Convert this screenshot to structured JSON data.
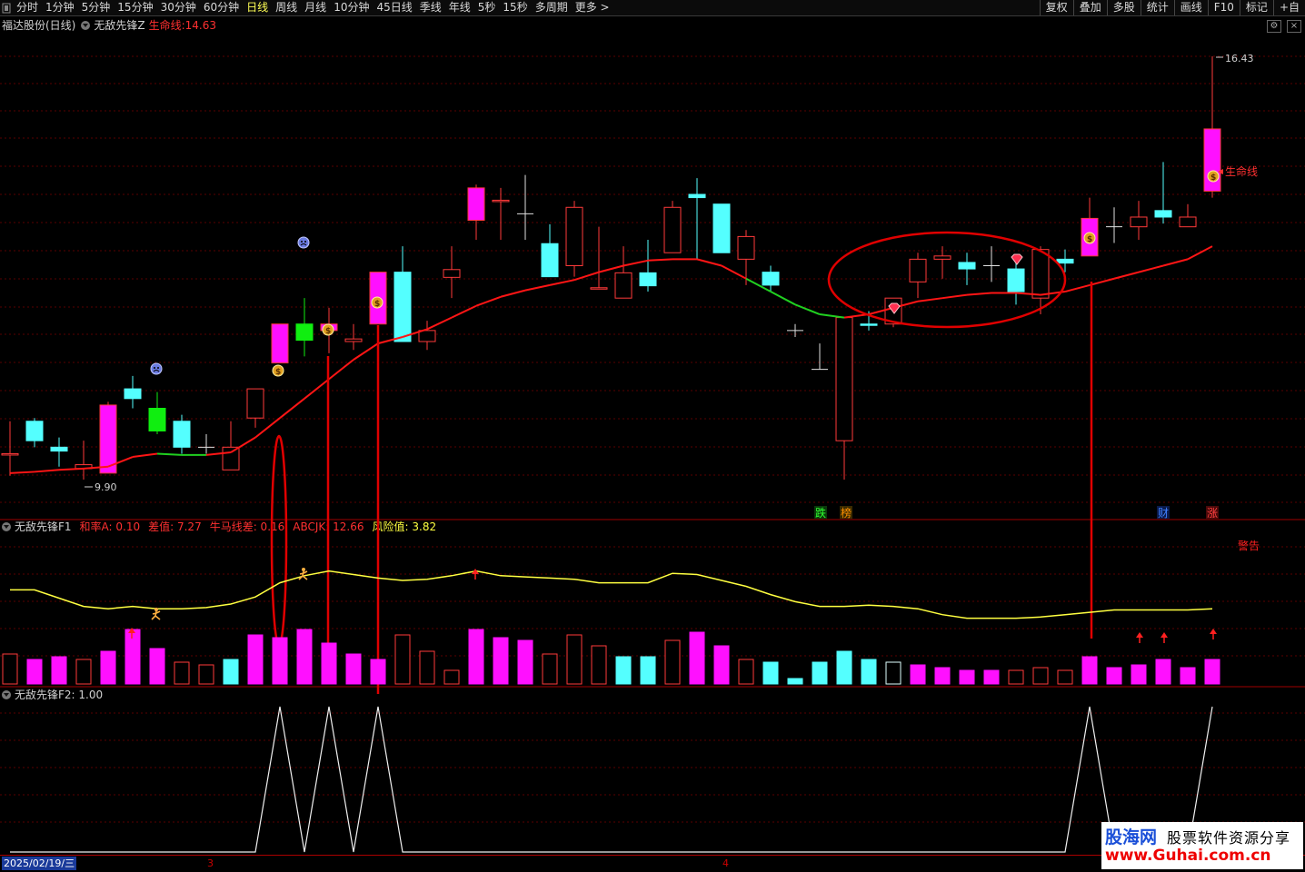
{
  "toolbar": {
    "periods": [
      "分时",
      "1分钟",
      "5分钟",
      "15分钟",
      "30分钟",
      "60分钟",
      "日线",
      "周线",
      "月线",
      "10分钟",
      "45日线",
      "季线",
      "年线",
      "5秒",
      "15秒",
      "多周期",
      "更多 >"
    ],
    "active": "日线",
    "right_buttons": [
      "复权",
      "叠加",
      "多股",
      "统计",
      "画线",
      "F10",
      "标记",
      "+自"
    ]
  },
  "main_header": {
    "stock": "福达股份(日线)",
    "indicator": "无敌先锋Z",
    "lifeline_label": "生命线:",
    "lifeline_value": "14.63"
  },
  "main_labels": {
    "high_price": "16.43",
    "low_price": "9.90",
    "lifeline_tag": "生命线",
    "tag_fall": "跌",
    "tag_rank": "榜",
    "tag_cai": "财",
    "tag_rise": "涨"
  },
  "f1_header": {
    "name": "无敌先锋F1",
    "items": [
      {
        "label": "和率A:",
        "value": "0.10",
        "color": "#ff3030"
      },
      {
        "label": "差值:",
        "value": "7.27",
        "color": "#ff3030"
      },
      {
        "label": "牛马线差:",
        "value": "0.16",
        "color": "#ff3030"
      },
      {
        "label": "ABCJK:",
        "value": "12.66",
        "color": "#ff3030"
      },
      {
        "label": "风险值:",
        "value": "3.82",
        "color": "#ffff40"
      }
    ],
    "warning": "警告"
  },
  "f2_header": {
    "name": "无敌先锋F2",
    "value": ": 1.00"
  },
  "date_bar": {
    "start": "2025/02/19/三",
    "month3": "3",
    "month4": "4"
  },
  "watermark": {
    "brand": "股海网",
    "slogan": "股票软件资源分享",
    "url": "www.Guhai.com.cn"
  },
  "colors": {
    "up": "#ff3a3a",
    "up_fill": "#ff10ff",
    "down": "#54ffff",
    "green_bar": "#10ee10",
    "lifeline": "#ff1515",
    "lifeline_green": "#20d020",
    "risk": "#ffff40"
  },
  "chart_data": {
    "type": "candlestick",
    "price_axis": {
      "min": 9.9,
      "max": 16.43
    },
    "candles": [
      {
        "o": 10.3,
        "c": 10.3,
        "h": 10.8,
        "l": 9.96,
        "kind": "up-hollow"
      },
      {
        "o": 10.5,
        "c": 10.8,
        "h": 10.85,
        "l": 10.4,
        "kind": "down"
      },
      {
        "o": 10.4,
        "c": 10.34,
        "h": 10.55,
        "l": 10.1,
        "kind": "down"
      },
      {
        "o": 10.07,
        "c": 10.13,
        "h": 10.5,
        "l": 9.9,
        "kind": "up-hollow"
      },
      {
        "o": 10.0,
        "c": 11.05,
        "h": 11.1,
        "l": 10.0,
        "kind": "up-solid"
      },
      {
        "o": 11.15,
        "c": 11.3,
        "h": 11.5,
        "l": 11.0,
        "kind": "down"
      },
      {
        "o": 11.0,
        "c": 10.65,
        "h": 11.25,
        "l": 10.6,
        "kind": "green"
      },
      {
        "o": 10.8,
        "c": 10.4,
        "h": 10.9,
        "l": 10.3,
        "kind": "down"
      },
      {
        "o": 10.4,
        "c": 10.4,
        "h": 10.6,
        "l": 10.3,
        "kind": "doji"
      },
      {
        "o": 10.05,
        "c": 10.4,
        "h": 10.8,
        "l": 10.05,
        "kind": "up-hollow"
      },
      {
        "o": 10.85,
        "c": 11.3,
        "h": 11.3,
        "l": 10.7,
        "kind": "up-hollow"
      },
      {
        "o": 11.7,
        "c": 12.3,
        "h": 12.3,
        "l": 11.7,
        "kind": "up-solid"
      },
      {
        "o": 12.05,
        "c": 12.3,
        "h": 12.7,
        "l": 11.8,
        "kind": "green"
      },
      {
        "o": 12.2,
        "c": 12.3,
        "h": 12.55,
        "l": 11.85,
        "kind": "up-solid"
      },
      {
        "o": 12.03,
        "c": 12.07,
        "h": 12.3,
        "l": 11.9,
        "kind": "up-hollow"
      },
      {
        "o": 12.3,
        "c": 13.1,
        "h": 13.1,
        "l": 12.3,
        "kind": "up-solid"
      },
      {
        "o": 13.1,
        "c": 12.03,
        "h": 13.5,
        "l": 12.03,
        "kind": "down"
      },
      {
        "o": 12.03,
        "c": 12.2,
        "h": 12.35,
        "l": 11.9,
        "kind": "up-hollow"
      },
      {
        "o": 13.02,
        "c": 13.14,
        "h": 13.5,
        "l": 12.7,
        "kind": "up-hollow"
      },
      {
        "o": 14.4,
        "c": 13.9,
        "h": 14.45,
        "l": 13.6,
        "kind": "up-solid"
      },
      {
        "o": 14.21,
        "c": 14.21,
        "h": 14.4,
        "l": 13.6,
        "kind": "up-hollow"
      },
      {
        "o": 14.0,
        "c": 14.0,
        "h": 14.6,
        "l": 13.6,
        "kind": "doji"
      },
      {
        "o": 13.54,
        "c": 13.03,
        "h": 13.84,
        "l": 13.03,
        "kind": "down"
      },
      {
        "o": 13.2,
        "c": 14.1,
        "h": 14.2,
        "l": 13.03,
        "kind": "up-hollow"
      },
      {
        "o": 12.86,
        "c": 12.86,
        "h": 13.8,
        "l": 12.86,
        "kind": "up-hollow"
      },
      {
        "o": 12.7,
        "c": 13.09,
        "h": 13.5,
        "l": 12.7,
        "kind": "up-hollow"
      },
      {
        "o": 13.09,
        "c": 12.89,
        "h": 13.6,
        "l": 12.8,
        "kind": "down"
      },
      {
        "o": 13.4,
        "c": 14.1,
        "h": 14.2,
        "l": 13.4,
        "kind": "up-hollow"
      },
      {
        "o": 14.3,
        "c": 14.25,
        "h": 14.55,
        "l": 13.3,
        "kind": "down"
      },
      {
        "o": 14.15,
        "c": 13.4,
        "h": 14.15,
        "l": 13.4,
        "kind": "down"
      },
      {
        "o": 13.3,
        "c": 13.65,
        "h": 13.75,
        "l": 12.9,
        "kind": "up-hollow"
      },
      {
        "o": 13.1,
        "c": 12.9,
        "h": 13.2,
        "l": 12.8,
        "kind": "down"
      },
      {
        "o": 12.2,
        "c": 12.2,
        "h": 12.3,
        "l": 12.1,
        "kind": "doji"
      },
      {
        "o": 11.6,
        "c": 11.6,
        "h": 12.0,
        "l": 11.6,
        "kind": "doji"
      },
      {
        "o": 10.5,
        "c": 12.4,
        "h": 12.4,
        "l": 9.9,
        "kind": "up-hollow"
      },
      {
        "o": 12.3,
        "c": 12.3,
        "h": 12.5,
        "l": 12.2,
        "kind": "down"
      },
      {
        "o": 12.3,
        "c": 12.7,
        "h": 12.7,
        "l": 12.25,
        "kind": "up-hollow"
      },
      {
        "o": 12.95,
        "c": 13.3,
        "h": 13.4,
        "l": 12.7,
        "kind": "up-hollow"
      },
      {
        "o": 13.3,
        "c": 13.35,
        "h": 13.5,
        "l": 13.0,
        "kind": "up-hollow"
      },
      {
        "o": 13.25,
        "c": 13.15,
        "h": 13.4,
        "l": 12.9,
        "kind": "down"
      },
      {
        "o": 13.2,
        "c": 13.2,
        "h": 13.5,
        "l": 12.95,
        "kind": "doji"
      },
      {
        "o": 13.15,
        "c": 12.8,
        "h": 13.3,
        "l": 12.6,
        "kind": "down"
      },
      {
        "o": 12.7,
        "c": 13.45,
        "h": 13.5,
        "l": 12.45,
        "kind": "up-hollow"
      },
      {
        "o": 13.3,
        "c": 13.24,
        "h": 13.45,
        "l": 13.1,
        "kind": "down"
      },
      {
        "o": 13.35,
        "c": 13.93,
        "h": 14.25,
        "l": 13.35,
        "kind": "up-solid"
      },
      {
        "o": 13.8,
        "c": 13.8,
        "h": 14.1,
        "l": 13.55,
        "kind": "doji"
      },
      {
        "o": 13.8,
        "c": 13.95,
        "h": 14.2,
        "l": 13.6,
        "kind": "up-hollow"
      },
      {
        "o": 13.95,
        "c": 14.05,
        "h": 14.8,
        "l": 13.85,
        "kind": "down"
      },
      {
        "o": 13.8,
        "c": 13.95,
        "h": 14.15,
        "l": 13.8,
        "kind": "up-hollow"
      },
      {
        "o": 14.35,
        "c": 15.31,
        "h": 16.43,
        "l": 14.25,
        "kind": "up-solid"
      }
    ],
    "lifeline": [
      10.0,
      10.02,
      10.05,
      10.07,
      10.1,
      10.25,
      10.3,
      10.28,
      10.28,
      10.32,
      10.55,
      10.85,
      11.15,
      11.45,
      11.75,
      12.0,
      12.1,
      12.22,
      12.4,
      12.58,
      12.72,
      12.82,
      12.9,
      12.98,
      13.1,
      13.2,
      13.28,
      13.3,
      13.3,
      13.2,
      13.0,
      12.8,
      12.6,
      12.45,
      12.4,
      12.45,
      12.55,
      12.65,
      12.7,
      12.75,
      12.78,
      12.78,
      12.75,
      12.8,
      12.9,
      13.0,
      13.1,
      13.2,
      13.3,
      13.5
    ],
    "lifeline_green_segments": [
      [
        6,
        8
      ],
      [
        30,
        34
      ]
    ],
    "f1_yellow": [
      0.62,
      0.62,
      0.55,
      0.48,
      0.46,
      0.48,
      0.46,
      0.46,
      0.47,
      0.5,
      0.56,
      0.68,
      0.74,
      0.78,
      0.75,
      0.72,
      0.7,
      0.71,
      0.74,
      0.78,
      0.74,
      0.73,
      0.72,
      0.71,
      0.68,
      0.68,
      0.68,
      0.76,
      0.75,
      0.7,
      0.65,
      0.58,
      0.52,
      0.48,
      0.48,
      0.49,
      0.48,
      0.46,
      0.41,
      0.38,
      0.38,
      0.38,
      0.39,
      0.41,
      0.43,
      0.45,
      0.45,
      0.45,
      0.45,
      0.46
    ],
    "f1_volume": [
      {
        "v": 0.55,
        "k": "up-hollow"
      },
      {
        "v": 0.45,
        "k": "up-solid"
      },
      {
        "v": 0.5,
        "k": "up-solid"
      },
      {
        "v": 0.45,
        "k": "up-hollow"
      },
      {
        "v": 0.6,
        "k": "up-solid"
      },
      {
        "v": 1.0,
        "k": "up-solid"
      },
      {
        "v": 0.65,
        "k": "up-solid"
      },
      {
        "v": 0.4,
        "k": "up-hollow"
      },
      {
        "v": 0.35,
        "k": "up-hollow"
      },
      {
        "v": 0.45,
        "k": "down"
      },
      {
        "v": 0.9,
        "k": "up-solid"
      },
      {
        "v": 0.85,
        "k": "up-solid"
      },
      {
        "v": 1.0,
        "k": "up-solid"
      },
      {
        "v": 0.75,
        "k": "up-solid"
      },
      {
        "v": 0.55,
        "k": "up-solid"
      },
      {
        "v": 0.45,
        "k": "up-solid"
      },
      {
        "v": 0.9,
        "k": "up-hollow"
      },
      {
        "v": 0.6,
        "k": "up-hollow"
      },
      {
        "v": 0.25,
        "k": "up-hollow"
      },
      {
        "v": 1.0,
        "k": "up-solid"
      },
      {
        "v": 0.85,
        "k": "up-solid"
      },
      {
        "v": 0.8,
        "k": "up-solid"
      },
      {
        "v": 0.55,
        "k": "up-hollow"
      },
      {
        "v": 0.9,
        "k": "up-hollow"
      },
      {
        "v": 0.7,
        "k": "up-hollow"
      },
      {
        "v": 0.5,
        "k": "down"
      },
      {
        "v": 0.5,
        "k": "down"
      },
      {
        "v": 0.8,
        "k": "up-hollow"
      },
      {
        "v": 0.95,
        "k": "up-solid"
      },
      {
        "v": 0.7,
        "k": "up-solid"
      },
      {
        "v": 0.45,
        "k": "up-hollow"
      },
      {
        "v": 0.4,
        "k": "down"
      },
      {
        "v": 0.1,
        "k": "down"
      },
      {
        "v": 0.4,
        "k": "down"
      },
      {
        "v": 0.6,
        "k": "down"
      },
      {
        "v": 0.45,
        "k": "down"
      },
      {
        "v": 0.4,
        "k": "down-hollow"
      },
      {
        "v": 0.35,
        "k": "up-solid"
      },
      {
        "v": 0.3,
        "k": "up-solid"
      },
      {
        "v": 0.25,
        "k": "up-solid"
      },
      {
        "v": 0.25,
        "k": "up-solid"
      },
      {
        "v": 0.25,
        "k": "up-hollow"
      },
      {
        "v": 0.3,
        "k": "up-hollow"
      },
      {
        "v": 0.25,
        "k": "up-hollow"
      },
      {
        "v": 0.5,
        "k": "up-solid"
      },
      {
        "v": 0.3,
        "k": "up-solid"
      },
      {
        "v": 0.35,
        "k": "up-solid"
      },
      {
        "v": 0.45,
        "k": "up-solid"
      },
      {
        "v": 0.3,
        "k": "up-solid"
      },
      {
        "v": 0.45,
        "k": "up-solid"
      }
    ],
    "f2_signal": [
      0,
      0,
      0,
      0,
      0,
      0,
      0,
      0,
      0,
      0,
      0,
      1,
      0,
      1,
      0,
      1,
      0,
      0,
      0,
      0,
      0,
      0,
      0,
      0,
      0,
      0,
      0,
      0,
      0,
      0,
      0,
      0,
      0,
      0,
      0,
      0,
      0,
      0,
      0,
      0,
      0,
      0,
      0,
      0,
      1,
      0,
      0,
      0,
      0,
      1
    ],
    "markers": {
      "money_bags": [
        11,
        13,
        15,
        49,
        44
      ],
      "sad_faces": [
        6,
        12
      ],
      "diamonds": [
        36,
        41
      ],
      "runners": [
        6,
        12
      ],
      "red_arrows": [
        5,
        19,
        46,
        47,
        49
      ],
      "f2_top_value": 1.0
    }
  }
}
